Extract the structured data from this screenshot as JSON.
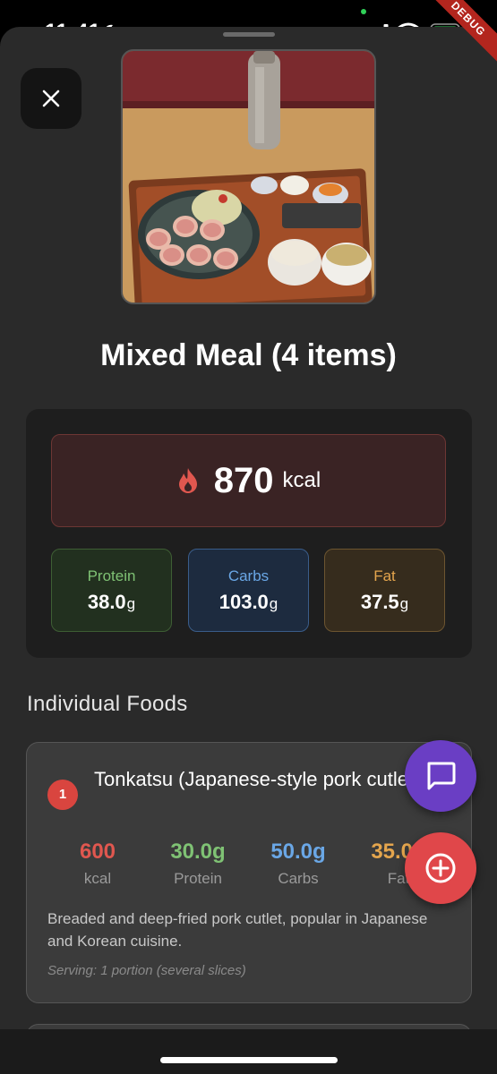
{
  "status_bar": {
    "time": "11:41",
    "debug_label": "DEBUG"
  },
  "meal": {
    "title": "Mixed Meal (4 items)",
    "calories": "870",
    "calories_unit": "kcal",
    "macros": {
      "protein": {
        "label": "Protein",
        "value": "38.0",
        "unit": "g"
      },
      "carbs": {
        "label": "Carbs",
        "value": "103.0",
        "unit": "g"
      },
      "fat": {
        "label": "Fat",
        "value": "37.5",
        "unit": "g"
      }
    }
  },
  "section_title": "Individual Foods",
  "foods": [
    {
      "number": "1",
      "name": "Tonkatsu (Japanese-style pork cutlet)",
      "kcal": "600",
      "kcal_label": "kcal",
      "protein": "30.0g",
      "protein_label": "Protein",
      "carbs": "50.0g",
      "carbs_label": "Carbs",
      "fat": "35.0g",
      "fat_label": "Fat",
      "description": "Breaded and deep-fried pork cutlet, popular in Japanese and Korean cuisine.",
      "serving": "Serving: 1 portion (several slices)"
    }
  ],
  "colors": {
    "calorie_red": "#e0574f",
    "protein_green": "#7fc274",
    "carbs_blue": "#6aa7e6",
    "fat_orange": "#e4a54d",
    "fab_chat": "#6a3ec4",
    "fab_add": "#e0474a"
  },
  "icons": {
    "close": "close-icon",
    "flame": "flame-icon",
    "chat": "chat-icon",
    "add": "add-circle-icon"
  }
}
